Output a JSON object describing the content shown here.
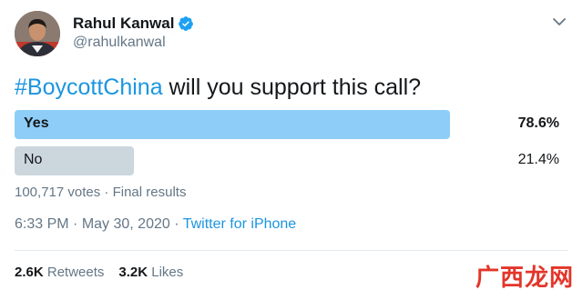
{
  "author": {
    "display_name": "Rahul Kanwal",
    "handle": "@rahulkanwal",
    "verified": true
  },
  "tweet": {
    "hashtag": "#BoycottChina",
    "text": " will you support this call?"
  },
  "poll": {
    "options": [
      {
        "label": "Yes",
        "percent": "78.6%",
        "fraction": 0.786,
        "winner": true
      },
      {
        "label": "No",
        "percent": "21.4%",
        "fraction": 0.214,
        "winner": false
      }
    ],
    "votes": "100,717 votes",
    "separator": " · ",
    "status": "Final results"
  },
  "meta": {
    "time": "6:33 PM",
    "separator": " · ",
    "date": "May 30, 2020",
    "source": "Twitter for iPhone"
  },
  "stats": {
    "retweets_count": "2.6K",
    "retweets_label": " Retweets",
    "likes_count": "3.2K",
    "likes_label": " Likes"
  },
  "watermark": "广西龙网",
  "colors": {
    "brand_blue": "#1b95e0",
    "poll_winner": "#8ecdf7",
    "poll_loser": "#ccd6dd",
    "secondary_text": "#657786",
    "watermark_red": "#e3352a"
  },
  "icons": {
    "verified": "verified-badge-icon",
    "menu": "chevron-down-icon"
  }
}
